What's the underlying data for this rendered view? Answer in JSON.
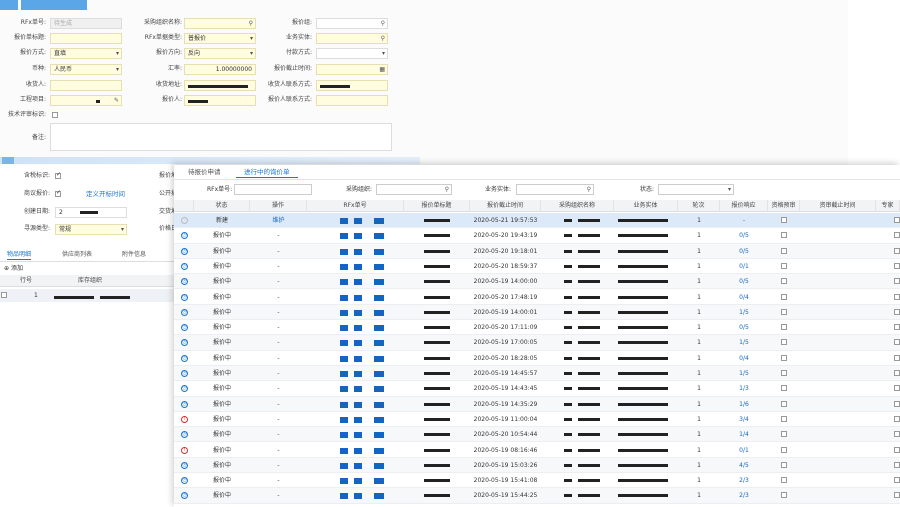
{
  "form": {
    "rfx_no_label": "RFx单号:",
    "rfx_no_value": "待生成",
    "purchase_org_label": "采购组织名称:",
    "quote_group_label": "报价组:",
    "title_label": "报价单标题:",
    "rfx_type_label": "RFx单据类型:",
    "rfx_type_value": "普报价",
    "business_entity_label": "业务实体:",
    "quote_method_label": "报价方式:",
    "quote_method_value": "直填",
    "quote_direction_label": "报价方向:",
    "quote_direction_value": "反向",
    "payment_method_label": "付款方式:",
    "currency_label": "币种:",
    "currency_value": "人民币",
    "exchange_rate_label": "汇率:",
    "exchange_rate_value": "1.00000000",
    "deadline_label": "报价截止时间:",
    "receiver_label": "收货人:",
    "receive_address_label": "收货地址:",
    "contact_label": "收货人联系方式:",
    "project_label": "工程项目:",
    "quoter_label": "报价人:",
    "quoter_contact_label": "报价人联系方式:",
    "tech_review_label": "技术评审标识:",
    "remark_label": "备注:"
  },
  "left": {
    "tax_label": "含税标识:",
    "bid_label": "商议报价:",
    "custom_link": "定义开标时间",
    "created_label": "创建日期:",
    "created_value": "2",
    "seek_type_label": "寻源类型:",
    "seek_type_value": "常规",
    "right_labels": [
      "报价地",
      "公开招",
      "交货地",
      "价格日"
    ],
    "tabs": [
      "物品明细",
      "供应商列表",
      "附件信息"
    ],
    "add_label": "添加",
    "col_line": "行号",
    "col_inventory": "库存组织",
    "row_no": "1"
  },
  "overlay": {
    "tabs": [
      "待报价申请",
      "进行中的询价单"
    ],
    "filters": {
      "rfx_no": "RFx单号:",
      "purchase_org": "采购组织:",
      "business_entity": "业务实体:",
      "status": "状态:"
    },
    "columns": [
      "状态",
      "操作",
      "RFx单号",
      "报价单标题",
      "报价截止时间",
      "采购组织名称",
      "业务实体",
      "轮次",
      "报价响应",
      "资格预审",
      "资审截止时间",
      "专家"
    ],
    "rows": [
      {
        "status": "新建",
        "op": "维护",
        "deadline": "2020-05-21 19:57:53",
        "round": "1",
        "resp": "-",
        "icon": "gray"
      },
      {
        "status": "报价中",
        "op": "-",
        "deadline": "2020-05-20 19:43:19",
        "round": "1",
        "resp": "0/5",
        "icon": "blue"
      },
      {
        "status": "报价中",
        "op": "-",
        "deadline": "2020-05-20 19:18:01",
        "round": "1",
        "resp": "0/5",
        "icon": "blue"
      },
      {
        "status": "报价中",
        "op": "-",
        "deadline": "2020-05-20 18:59:37",
        "round": "1",
        "resp": "0/1",
        "icon": "blue"
      },
      {
        "status": "报价中",
        "op": "-",
        "deadline": "2020-05-19 14:00:00",
        "round": "1",
        "resp": "0/5",
        "icon": "blue"
      },
      {
        "status": "报价中",
        "op": "-",
        "deadline": "2020-05-20 17:48:19",
        "round": "1",
        "resp": "0/4",
        "icon": "blue"
      },
      {
        "status": "报价中",
        "op": "-",
        "deadline": "2020-05-19 14:00:01",
        "round": "1",
        "resp": "1/5",
        "icon": "blue"
      },
      {
        "status": "报价中",
        "op": "-",
        "deadline": "2020-05-20 17:11:09",
        "round": "1",
        "resp": "0/5",
        "icon": "blue"
      },
      {
        "status": "报价中",
        "op": "-",
        "deadline": "2020-05-19 17:00:05",
        "round": "1",
        "resp": "1/5",
        "icon": "blue"
      },
      {
        "status": "报价中",
        "op": "-",
        "deadline": "2020-05-20 18:28:05",
        "round": "1",
        "resp": "0/4",
        "icon": "blue"
      },
      {
        "status": "报价中",
        "op": "-",
        "deadline": "2020-05-19 14:45:57",
        "round": "1",
        "resp": "1/5",
        "icon": "blue"
      },
      {
        "status": "报价中",
        "op": "-",
        "deadline": "2020-05-19 14:43:45",
        "round": "1",
        "resp": "1/3",
        "icon": "blue"
      },
      {
        "status": "报价中",
        "op": "-",
        "deadline": "2020-05-19 14:35:29",
        "round": "1",
        "resp": "1/6",
        "icon": "blue"
      },
      {
        "status": "报价中",
        "op": "-",
        "deadline": "2020-05-19 11:00:04",
        "round": "1",
        "resp": "3/4",
        "icon": "red"
      },
      {
        "status": "报价中",
        "op": "-",
        "deadline": "2020-05-20 10:54:44",
        "round": "1",
        "resp": "1/4",
        "icon": "blue"
      },
      {
        "status": "报价中",
        "op": "-",
        "deadline": "2020-05-19 08:16:46",
        "round": "1",
        "resp": "0/1",
        "icon": "red"
      },
      {
        "status": "报价中",
        "op": "-",
        "deadline": "2020-05-19 15:03:26",
        "round": "1",
        "resp": "4/5",
        "icon": "blue"
      },
      {
        "status": "报价中",
        "op": "-",
        "deadline": "2020-05-19 15:41:08",
        "round": "1",
        "resp": "2/3",
        "icon": "blue"
      },
      {
        "status": "报价中",
        "op": "-",
        "deadline": "2020-05-19 15:44:25",
        "round": "1",
        "resp": "2/3",
        "icon": "blue"
      }
    ]
  }
}
